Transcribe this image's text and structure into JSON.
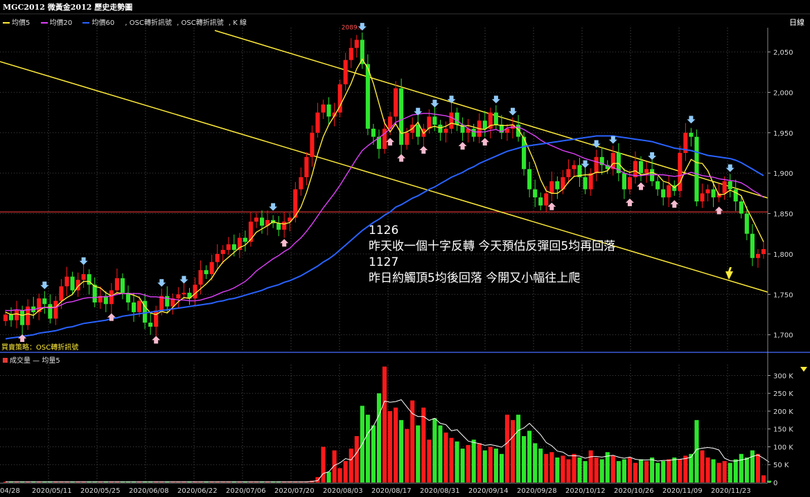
{
  "header": {
    "title": "MGC2012 微黃金2012  歷史走勢圖",
    "period": "日線",
    "strategy": "買賣策略：OSC轉折訊號",
    "legend": [
      {
        "label": "均價5",
        "color": "#ffeb3b"
      },
      {
        "label": "均價20",
        "color": "#e040fb"
      },
      {
        "label": "均價60",
        "color": "#2962ff"
      },
      {
        "label": "OSC轉折訊號",
        "color": "#bbbbbb"
      },
      {
        "label": "OSC轉折訊號",
        "color": "#bbbbbb"
      },
      {
        "label": "K 線",
        "color": "#bbbbbb"
      }
    ],
    "volume_legend": "成交量 — 均量5"
  },
  "annotation": {
    "line1": "1126",
    "line2": "昨天收一個十字反轉 今天預估反彈回5均再回落",
    "line3": "1127",
    "line4": "昨日約觸頂5均後回落 今開又小幅往上爬"
  },
  "chart_data": [
    {
      "type": "candlestick",
      "title": "MGC2012 微黃金2012  歷史走勢圖",
      "y_ticks": [
        1700,
        1750,
        1800,
        1850,
        1900,
        1950,
        2000,
        2050
      ],
      "y_tick_labels": [
        "1,700",
        "1,750",
        "1,800",
        "1,850",
        "1,900",
        "1,950",
        "2,000",
        "2,050"
      ],
      "ylim": [
        1680,
        2080
      ],
      "peak_label": "2089.3",
      "x_tick_labels": [
        "04/28",
        "2020/05/11",
        "2020/05/25",
        "2020/06/08",
        "2020/06/22",
        "2020/07/06",
        "2020/07/20",
        "2020/08/03",
        "2020/08/17",
        "2020/08/31",
        "2020/09/14",
        "2020/09/28",
        "2020/10/12",
        "2020/10/26",
        "2020/11/09",
        "2020/11/23"
      ],
      "close": [
        1725,
        1718,
        1730,
        1712,
        1735,
        1728,
        1745,
        1738,
        1720,
        1742,
        1760,
        1772,
        1755,
        1768,
        1775,
        1762,
        1740,
        1748,
        1738,
        1755,
        1770,
        1752,
        1740,
        1728,
        1742,
        1715,
        1710,
        1730,
        1748,
        1735,
        1745,
        1750,
        1752,
        1745,
        1762,
        1780,
        1775,
        1790,
        1800,
        1805,
        1812,
        1805,
        1820,
        1815,
        1840,
        1845,
        1835,
        1842,
        1838,
        1830,
        1840,
        1845,
        1880,
        1895,
        1920,
        1950,
        1975,
        1985,
        1970,
        1975,
        2010,
        2040,
        2055,
        2065,
        2035,
        1955,
        1945,
        1930,
        1955,
        1970,
        2005,
        1935,
        1950,
        1960,
        1945,
        1955,
        1970,
        1960,
        1950,
        1955,
        1975,
        1960,
        1950,
        1955,
        1945,
        1965,
        1955,
        1975,
        1960,
        1950,
        1955,
        1960,
        1945,
        1905,
        1880,
        1870,
        1860,
        1875,
        1890,
        1880,
        1895,
        1905,
        1910,
        1895,
        1880,
        1900,
        1920,
        1910,
        1905,
        1925,
        1900,
        1880,
        1895,
        1915,
        1900,
        1905,
        1890,
        1880,
        1870,
        1885,
        1878,
        1925,
        1950,
        1945,
        1865,
        1875,
        1880,
        1870,
        1875,
        1890,
        1880,
        1865,
        1850,
        1825,
        1795,
        1800,
        1806
      ],
      "ma5": [
        1728,
        1725,
        1726,
        1724,
        1726,
        1724,
        1730,
        1734,
        1734,
        1734,
        1741,
        1746,
        1750,
        1760,
        1766,
        1766,
        1760,
        1758,
        1752,
        1748,
        1752,
        1751,
        1751,
        1749,
        1746,
        1735,
        1727,
        1725,
        1729,
        1727,
        1734,
        1741,
        1746,
        1745,
        1751,
        1757,
        1763,
        1770,
        1781,
        1790,
        1796,
        1802,
        1808,
        1811,
        1818,
        1827,
        1831,
        1835,
        1840,
        1838,
        1837,
        1839,
        1847,
        1858,
        1876,
        1898,
        1924,
        1945,
        1960,
        1971,
        1983,
        1997,
        2011,
        2029,
        2041,
        2030,
        2011,
        1986,
        1962,
        1951,
        1961,
        1949,
        1951,
        1955,
        1963,
        1949,
        1956,
        1958,
        1956,
        1958,
        1962,
        1960,
        1958,
        1959,
        1957,
        1955,
        1954,
        1959,
        1960,
        1959,
        1959,
        1960,
        1954,
        1943,
        1928,
        1912,
        1892,
        1878,
        1875,
        1875,
        1880,
        1889,
        1896,
        1897,
        1898,
        1898,
        1901,
        1901,
        1903,
        1912,
        1912,
        1904,
        1901,
        1903,
        1898,
        1899,
        1901,
        1898,
        1890,
        1888,
        1882,
        1888,
        1904,
        1917,
        1913,
        1912,
        1903,
        1887,
        1873,
        1874,
        1879,
        1876,
        1872,
        1856,
        1843,
        1829,
        1815
      ],
      "ma20": [
        1730,
        1730,
        1731,
        1730,
        1731,
        1731,
        1733,
        1734,
        1733,
        1734,
        1737,
        1740,
        1741,
        1743,
        1745,
        1746,
        1746,
        1747,
        1747,
        1748,
        1750,
        1751,
        1751,
        1751,
        1751,
        1749,
        1747,
        1747,
        1746,
        1745,
        1744,
        1743,
        1743,
        1742,
        1742,
        1743,
        1745,
        1747,
        1750,
        1753,
        1755,
        1758,
        1762,
        1766,
        1772,
        1779,
        1784,
        1789,
        1794,
        1798,
        1803,
        1807,
        1814,
        1820,
        1828,
        1837,
        1847,
        1857,
        1866,
        1875,
        1885,
        1896,
        1907,
        1918,
        1928,
        1934,
        1939,
        1944,
        1949,
        1955,
        1963,
        1966,
        1969,
        1972,
        1973,
        1974,
        1974,
        1973,
        1972,
        1971,
        1969,
        1965,
        1960,
        1955,
        1951,
        1951,
        1951,
        1953,
        1954,
        1951,
        1956,
        1957,
        1957,
        1954,
        1950,
        1946,
        1941,
        1937,
        1934,
        1931,
        1928,
        1926,
        1924,
        1921,
        1918,
        1916,
        1914,
        1912,
        1909,
        1907,
        1904,
        1900,
        1898,
        1897,
        1897,
        1898,
        1898,
        1898,
        1898,
        1897,
        1896,
        1897,
        1899,
        1901,
        1899,
        1897,
        1896,
        1895,
        1893,
        1892,
        1891,
        1890,
        1888,
        1884,
        1879,
        1875,
        1870
      ],
      "ma60": [
        1695,
        1696,
        1697,
        1698,
        1699,
        1700,
        1702,
        1703,
        1704,
        1705,
        1707,
        1709,
        1710,
        1712,
        1714,
        1715,
        1716,
        1717,
        1718,
        1720,
        1721,
        1723,
        1724,
        1725,
        1726,
        1727,
        1728,
        1729,
        1730,
        1731,
        1732,
        1733,
        1734,
        1735,
        1736,
        1737,
        1738,
        1739,
        1741,
        1742,
        1744,
        1745,
        1747,
        1749,
        1751,
        1753,
        1755,
        1758,
        1760,
        1762,
        1765,
        1767,
        1770,
        1773,
        1777,
        1781,
        1785,
        1790,
        1794,
        1799,
        1805,
        1811,
        1817,
        1823,
        1829,
        1834,
        1839,
        1843,
        1848,
        1852,
        1858,
        1861,
        1865,
        1869,
        1872,
        1876,
        1880,
        1883,
        1887,
        1891,
        1895,
        1898,
        1901,
        1905,
        1908,
        1912,
        1915,
        1918,
        1921,
        1924,
        1927,
        1929,
        1931,
        1933,
        1934,
        1935,
        1936,
        1937,
        1938,
        1939,
        1940,
        1941,
        1942,
        1943,
        1944,
        1945,
        1946,
        1946,
        1946,
        1946,
        1945,
        1944,
        1943,
        1942,
        1941,
        1940,
        1939,
        1937,
        1935,
        1933,
        1931,
        1930,
        1929,
        1928,
        1926,
        1924,
        1922,
        1921,
        1920,
        1919,
        1918,
        1916,
        1913,
        1909,
        1905,
        1901,
        1897
      ],
      "support_level": 1852
    },
    {
      "type": "bar",
      "title": "成交量 — 均量5",
      "y_tick_labels": [
        "0",
        "50 K",
        "100 K",
        "150 K",
        "200 K",
        "250 K",
        "300 K"
      ],
      "ylim": [
        0,
        330000
      ],
      "volume": [
        2000,
        2000,
        2000,
        2000,
        2000,
        2000,
        2000,
        2000,
        2000,
        2000,
        2000,
        2000,
        2000,
        2000,
        2000,
        2000,
        2000,
        2000,
        2000,
        2000,
        2000,
        2000,
        2000,
        2000,
        2000,
        2000,
        2000,
        2000,
        2000,
        2000,
        2000,
        2000,
        2000,
        2000,
        2000,
        2000,
        2000,
        2000,
        2000,
        2000,
        2000,
        2000,
        2000,
        2000,
        2000,
        2000,
        2000,
        2000,
        2000,
        2000,
        2000,
        2000,
        2000,
        2000,
        3000,
        5000,
        15000,
        100000,
        30000,
        90000,
        40000,
        60000,
        95000,
        130000,
        215000,
        190000,
        160000,
        250000,
        325000,
        200000,
        210000,
        175000,
        150000,
        230000,
        160000,
        210000,
        120000,
        180000,
        160000,
        140000,
        125000,
        115000,
        95000,
        105000,
        120000,
        110000,
        90000,
        100000,
        95000,
        80000,
        190000,
        175000,
        190000,
        130000,
        145000,
        110000,
        95000,
        80000,
        85000,
        70000,
        75000,
        65000,
        80000,
        70000,
        60000,
        90000,
        70000,
        65000,
        85000,
        75000,
        60000,
        65000,
        70000,
        55000,
        65000,
        60000,
        70000,
        55000,
        60000,
        65000,
        70000,
        65000,
        75000,
        80000,
        175000,
        90000,
        70000,
        65000,
        55000,
        60000,
        55000,
        65000,
        80000,
        70000,
        90000,
        80000,
        20000,
        5000
      ],
      "volume_ma5": [
        2000,
        2000,
        2000,
        2000,
        2000,
        2000,
        2000,
        2000,
        2000,
        2000,
        2000,
        2000,
        2000,
        2000,
        2000,
        2000,
        2000,
        2000,
        2000,
        2000,
        2000,
        2000,
        2000,
        2000,
        2000,
        2000,
        2000,
        2000,
        2000,
        2000,
        2000,
        2000,
        2000,
        2000,
        2000,
        2000,
        2000,
        2000,
        2000,
        2000,
        2000,
        2000,
        2000,
        2000,
        2000,
        2000,
        2000,
        2000,
        2000,
        2000,
        2000,
        2000,
        2000,
        2000,
        2000,
        3000,
        5000,
        25000,
        30000,
        48000,
        55000,
        67000,
        63000,
        83000,
        108000,
        138000,
        158000,
        189000,
        228000,
        225000,
        227000,
        232000,
        212000,
        193000,
        185000,
        185000,
        174000,
        180000,
        166000,
        162000,
        145000,
        148000,
        132000,
        116000,
        112000,
        109000,
        104000,
        106000,
        103000,
        99000,
        111000,
        128000,
        146000,
        153000,
        166000,
        150000,
        134000,
        112000,
        103000,
        88000,
        85000,
        75000,
        75000,
        74000,
        68000,
        72000,
        73000,
        71000,
        74000,
        76000,
        71000,
        68000,
        71000,
        65000,
        63000,
        63000,
        64000,
        60000,
        62000,
        62000,
        64000,
        65000,
        67000,
        71000,
        93000,
        96000,
        98000,
        96000,
        91000,
        68000,
        61000,
        60000,
        63000,
        66000,
        73000,
        77000,
        68000,
        57000
      ]
    }
  ]
}
